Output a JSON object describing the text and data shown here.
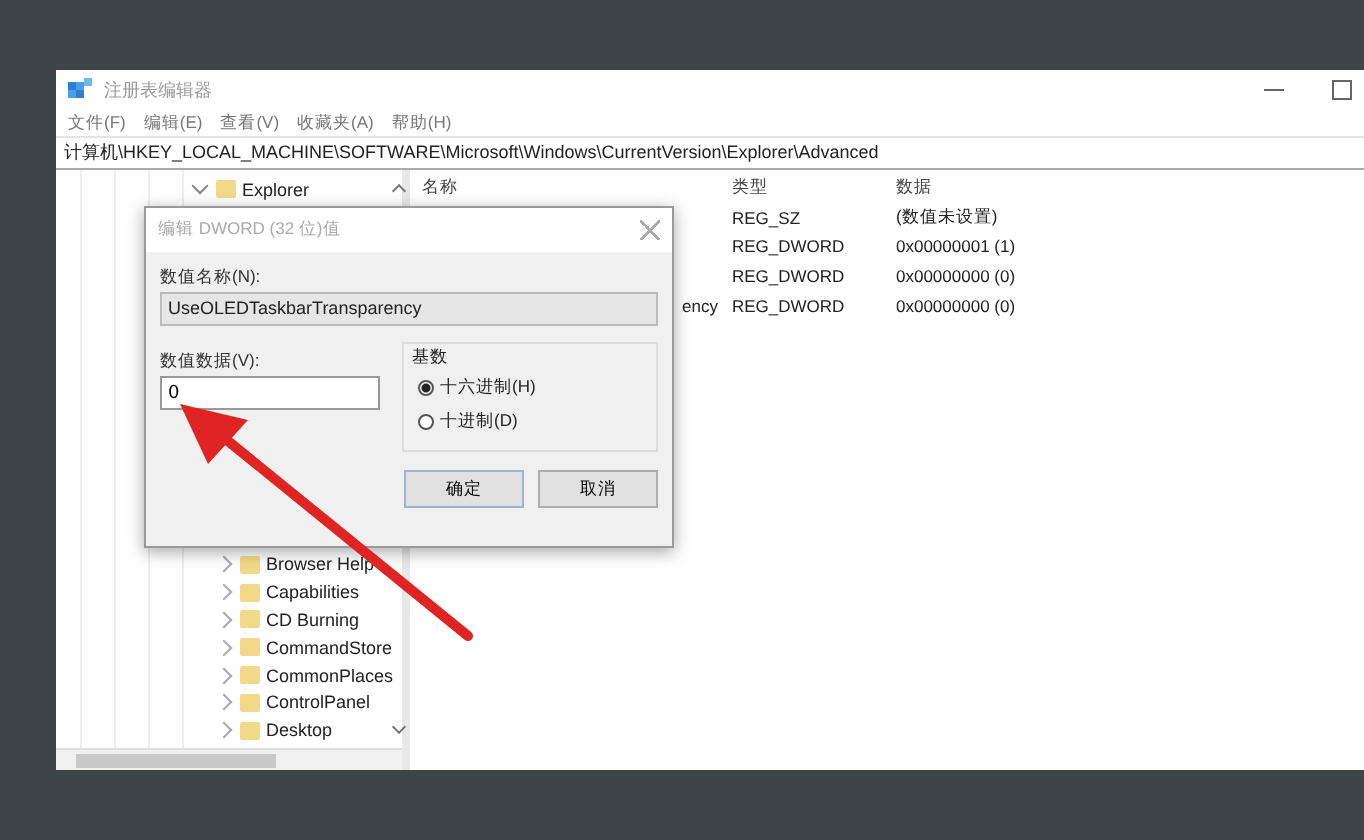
{
  "window": {
    "title": "注册表编辑器"
  },
  "menu": [
    "文件(F)",
    "编辑(E)",
    "查看(V)",
    "收藏夹(A)",
    "帮助(H)"
  ],
  "address": "计算机\\HKEY_LOCAL_MACHINE\\SOFTWARE\\Microsoft\\Windows\\CurrentVersion\\Explorer\\Advanced",
  "tree": [
    {
      "label": "Explorer",
      "expanded": true,
      "children": [
        {
          "label": "Browser Help",
          "expanded": false
        },
        {
          "label": "Capabilities",
          "expanded": false
        },
        {
          "label": "CD Burning",
          "expanded": false
        },
        {
          "label": "CommandStore",
          "expanded": false
        },
        {
          "label": "CommonPlaces",
          "expanded": false
        },
        {
          "label": "ControlPanel",
          "expanded": false
        },
        {
          "label": "Desktop",
          "expanded": false
        }
      ]
    }
  ],
  "table": {
    "columns": [
      "名称",
      "类型",
      "数据"
    ],
    "rows": [
      {
        "type": "REG_SZ",
        "data": "(数值未设置)"
      },
      {
        "type": "REG_DWORD",
        "data": "0x00000001 (1)"
      },
      {
        "type": "REG_DWORD",
        "data": "0x00000000 (0)"
      },
      {
        "name": "ency",
        "type": "REG_DWORD",
        "data": "0x00000000 (0)"
      }
    ]
  },
  "dialog": {
    "title": "编辑 DWORD (32 位)值",
    "name_label": "数值名称(N):",
    "name_value": "UseOLEDTaskbarTransparency",
    "data_label": "数值数据(V):",
    "data_value": "0",
    "base_label": "基数",
    "bases": [
      {
        "label": "十六进制(H)",
        "selected": true
      },
      {
        "label": "十进制(D)",
        "selected": false
      }
    ],
    "buttons": [
      "确定",
      "取消"
    ]
  }
}
